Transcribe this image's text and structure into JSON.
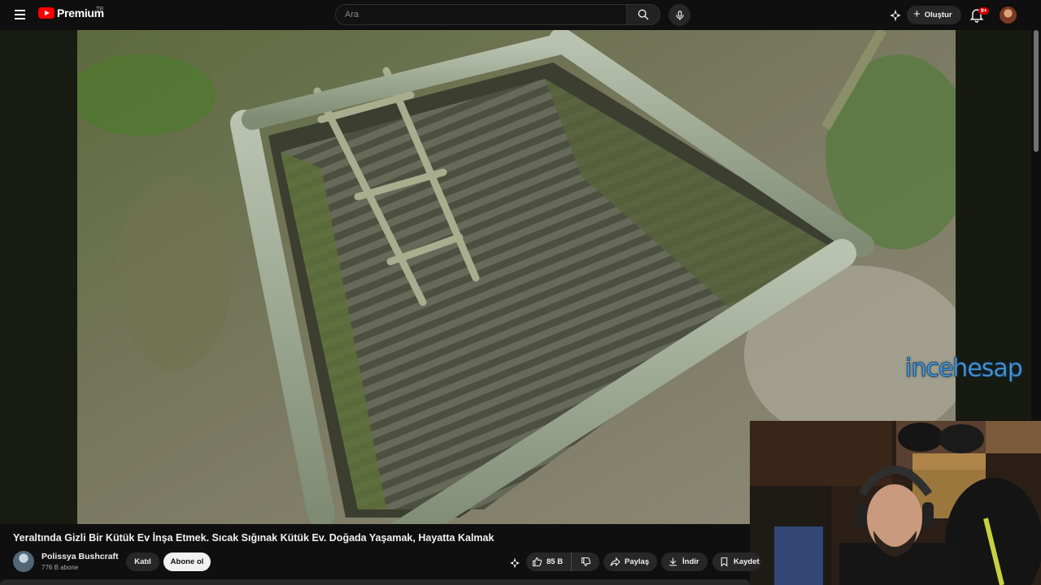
{
  "header": {
    "logo_text": "Premium",
    "country_code": "TR",
    "search_placeholder": "Ara",
    "create_label": "Oluştur",
    "notification_count": "9+"
  },
  "video": {
    "watermark": "incehesap"
  },
  "info": {
    "title": "Yeraltında Gizli Bir Kütük Ev İnşa Etmek. Sıcak Sığınak Kütük Ev. Doğada Yaşamak, Hayatta Kalmak",
    "channel_name": "Polissya Bushcraft",
    "subscribers": "776 B abone",
    "join_label": "Katıl",
    "subscribe_label": "Abone ol",
    "like_count": "85 B",
    "share_label": "Paylaş",
    "download_label": "İndir",
    "save_label": "Kaydet"
  },
  "icons": {
    "menu": "menu-icon",
    "search": "search-icon",
    "mic": "mic-icon",
    "mix": "sparkle-icon",
    "create": "plus-icon",
    "bell": "bell-icon",
    "like": "thumbs-up-icon",
    "dislike": "thumbs-down-icon",
    "share": "share-arrow-icon",
    "download": "download-icon",
    "save": "bookmark-icon"
  },
  "colors": {
    "brand_red": "#ff0000",
    "background": "#0f0f0f",
    "chip": "#272727",
    "watermark_blue": "#58a0dc"
  }
}
